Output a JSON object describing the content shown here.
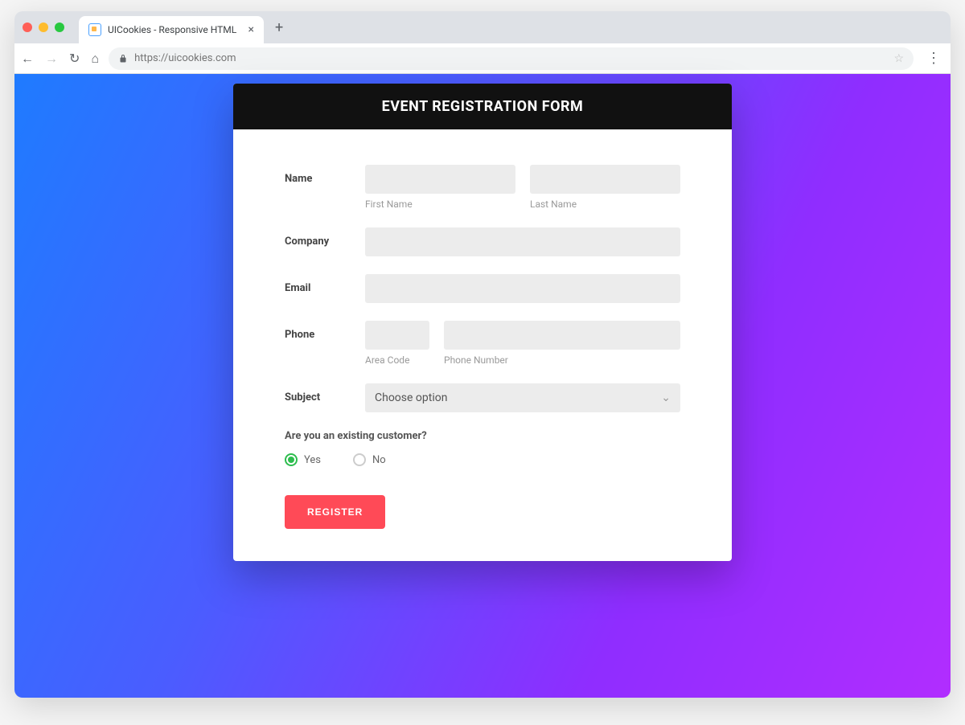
{
  "browser": {
    "tab_title": "UICookies - Responsive HTML",
    "url_display": "https://uicookies.com"
  },
  "form": {
    "title": "EVENT REGISTRATION FORM",
    "labels": {
      "name": "Name",
      "company": "Company",
      "email": "Email",
      "phone": "Phone",
      "subject": "Subject"
    },
    "sublabels": {
      "first_name": "First Name",
      "last_name": "Last Name",
      "area_code": "Area Code",
      "phone_number": "Phone Number"
    },
    "subject_placeholder": "Choose option",
    "existing_customer_question": "Are you an existing customer?",
    "radio_yes": "Yes",
    "radio_no": "No",
    "radio_selected": "yes",
    "submit_label": "REGISTER"
  }
}
